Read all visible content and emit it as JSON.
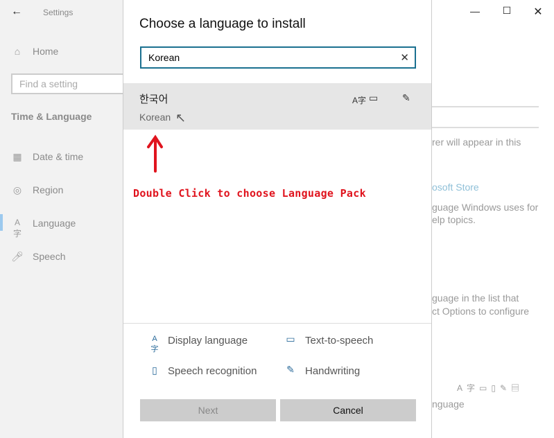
{
  "window": {
    "title": "Settings",
    "back_icon": "arrow-left-icon",
    "minimize_icon": "minimize-icon",
    "maximize_icon": "maximize-icon",
    "close_icon": "close-icon"
  },
  "sidebar": {
    "home": "Home",
    "search_placeholder": "Find a setting",
    "section": "Time & Language",
    "items": [
      {
        "label": "Date & time",
        "icon": "calendar-clock-icon"
      },
      {
        "label": "Region",
        "icon": "globe-icon"
      },
      {
        "label": "Language",
        "icon": "language-icon",
        "selected": true
      },
      {
        "label": "Speech",
        "icon": "microphone-icon"
      }
    ]
  },
  "background": {
    "lines": [
      "rer will appear in this",
      "osoft Store",
      "guage Windows uses for",
      "elp topics.",
      "guage in the list that",
      "ct Options to configure",
      "nguage"
    ],
    "link_color": "#8fc0d8"
  },
  "dialog": {
    "title": "Choose a language to install",
    "search_value": "Korean",
    "result": {
      "native": "한국어",
      "english": "Korean"
    },
    "annotation": "Double Click to choose Language Pack",
    "annotation_color": "#e0141e",
    "features": [
      "Display language",
      "Text-to-speech",
      "Speech recognition",
      "Handwriting"
    ],
    "next": "Next",
    "cancel": "Cancel",
    "next_disabled": true
  }
}
